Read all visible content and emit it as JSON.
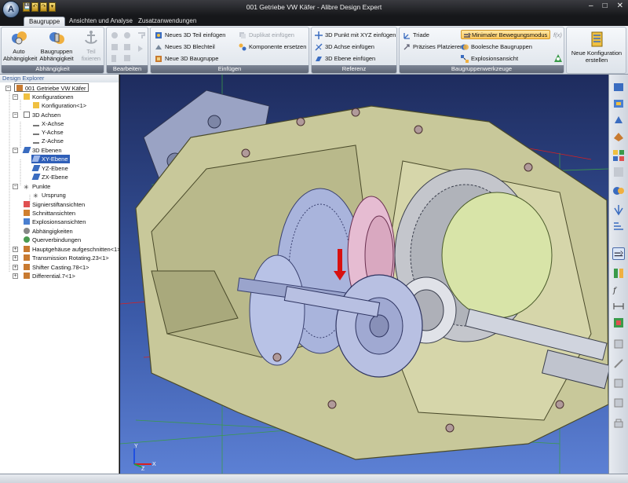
{
  "window": {
    "title": "001 Getriebe VW Käfer - Alibre Design Expert",
    "controls": [
      "–",
      "□",
      "✕"
    ],
    "quick_access": [
      "💾",
      "↶",
      "↷",
      "▾"
    ]
  },
  "tabs": [
    {
      "label": "Baugruppe",
      "active": true
    },
    {
      "label": "Ansichten und Analyse",
      "active": false
    },
    {
      "label": "Zusatzanwendungen",
      "active": false
    }
  ],
  "ribbon": {
    "abhaengigkeit": {
      "label": "Abhängigkeit",
      "auto": "Auto Abhängigkeit",
      "baugruppen": "Baugruppen Abhängigkeit",
      "teil": "Teil fixieren"
    },
    "bearbeiten": {
      "label": "Bearbeiten"
    },
    "einfuegen": {
      "label": "Einfügen",
      "neues_teil": "Neues 3D Teil einfügen",
      "duplikat": "Duplikat einfügen",
      "blechteil": "Neues 3D Blechteil",
      "komponente": "Komponente ersetzen",
      "baugruppe": "Neue 3D Baugruppe"
    },
    "referenz": {
      "label": "Referenz",
      "punkt": "3D Punkt mit XYZ einfügen",
      "achse": "3D Achse einfügen",
      "ebene": "3D Ebene einfügen"
    },
    "werkzeuge": {
      "label": "Baugruppenwerkzeuge",
      "triade": "Triade",
      "minimal": "Minimaler Bewegungsmodus",
      "fx": "f(x)",
      "praezises": "Präzises Platzieren",
      "boolesche": "Boolesche Baugruppen",
      "explosion": "Explosionsansicht"
    },
    "konfiguration": {
      "new": "Neue Konfiguration erstellen"
    }
  },
  "explorer": {
    "title": "Design Explorer",
    "nodes": [
      {
        "label": "001 Getriebe VW Käfer",
        "level": 0,
        "toggle": "−",
        "icon": "assembly"
      },
      {
        "label": "Konfigurationen",
        "level": 1,
        "toggle": "−",
        "icon": "config"
      },
      {
        "label": "Konfiguration<1>",
        "level": 2,
        "toggle": "",
        "icon": "config"
      },
      {
        "label": "3D Achsen",
        "level": 1,
        "toggle": "−",
        "icon": "axes"
      },
      {
        "label": "X-Achse",
        "level": 2,
        "toggle": "",
        "icon": "axis"
      },
      {
        "label": "Y-Achse",
        "level": 2,
        "toggle": "",
        "icon": "axis"
      },
      {
        "label": "Z-Achse",
        "level": 2,
        "toggle": "",
        "icon": "axis"
      },
      {
        "label": "3D Ebenen",
        "level": 1,
        "toggle": "−",
        "icon": "plane"
      },
      {
        "label": "XY-Ebene",
        "level": 2,
        "toggle": "",
        "icon": "plane",
        "selected": true
      },
      {
        "label": "YZ-Ebene",
        "level": 2,
        "toggle": "",
        "icon": "plane"
      },
      {
        "label": "ZX-Ebene",
        "level": 2,
        "toggle": "",
        "icon": "plane"
      },
      {
        "label": "Punkte",
        "level": 1,
        "toggle": "−",
        "icon": "point"
      },
      {
        "label": "Ursprung",
        "level": 2,
        "toggle": "",
        "icon": "point"
      },
      {
        "label": "Signierstiftansichten",
        "level": 1,
        "toggle": "",
        "icon": "pen"
      },
      {
        "label": "Schnittansichten",
        "level": 1,
        "toggle": "",
        "icon": "section"
      },
      {
        "label": "Explosionsansichten",
        "level": 1,
        "toggle": "",
        "icon": "explode"
      },
      {
        "label": "Abhängigkeiten",
        "level": 1,
        "toggle": "",
        "icon": "constraint"
      },
      {
        "label": "Querverbindungen",
        "level": 1,
        "toggle": "",
        "icon": "link"
      },
      {
        "label": "Hauptgehäuse aufgeschnitten<1>",
        "level": 1,
        "toggle": "+",
        "icon": "part"
      },
      {
        "label": "Transmission Rotating.23<1>",
        "level": 1,
        "toggle": "+",
        "icon": "part"
      },
      {
        "label": "Shifter Casting.78<1>",
        "level": 1,
        "toggle": "+",
        "icon": "part"
      },
      {
        "label": "Differential.7<1>",
        "level": 1,
        "toggle": "+",
        "icon": "part"
      }
    ]
  },
  "viewport": {
    "triad": {
      "x": "X",
      "y": "Y",
      "z": "Z"
    }
  },
  "vtools": [
    "add-part-icon",
    "add-assembly-icon",
    "move-part-icon",
    "rotate-part-icon",
    "cube-view-icon",
    "dice-pattern-icon",
    "replace-icon",
    "transparency-icon",
    "color-icon",
    "mirror-icon",
    "motion-icon",
    "minimal-motion-icon",
    "config-icon",
    "fx-icon",
    "dimension-icon",
    "triad-icon",
    "insert-part-icon",
    "constraint-icon",
    "anchor-icon",
    "lock-icon"
  ],
  "colors": {
    "title_bar": "#16171a",
    "ribbon": "#dde3ea",
    "group_label": "#5e6675",
    "viewport_top": "#1e2c5e",
    "viewport_bottom": "#5c80d4",
    "housing": "#c8c89a",
    "gear_blue": "#a9b4dc",
    "gear_pink": "#e6bcd2",
    "arrow_red": "#d81010",
    "selection": "#2f5fb8"
  }
}
